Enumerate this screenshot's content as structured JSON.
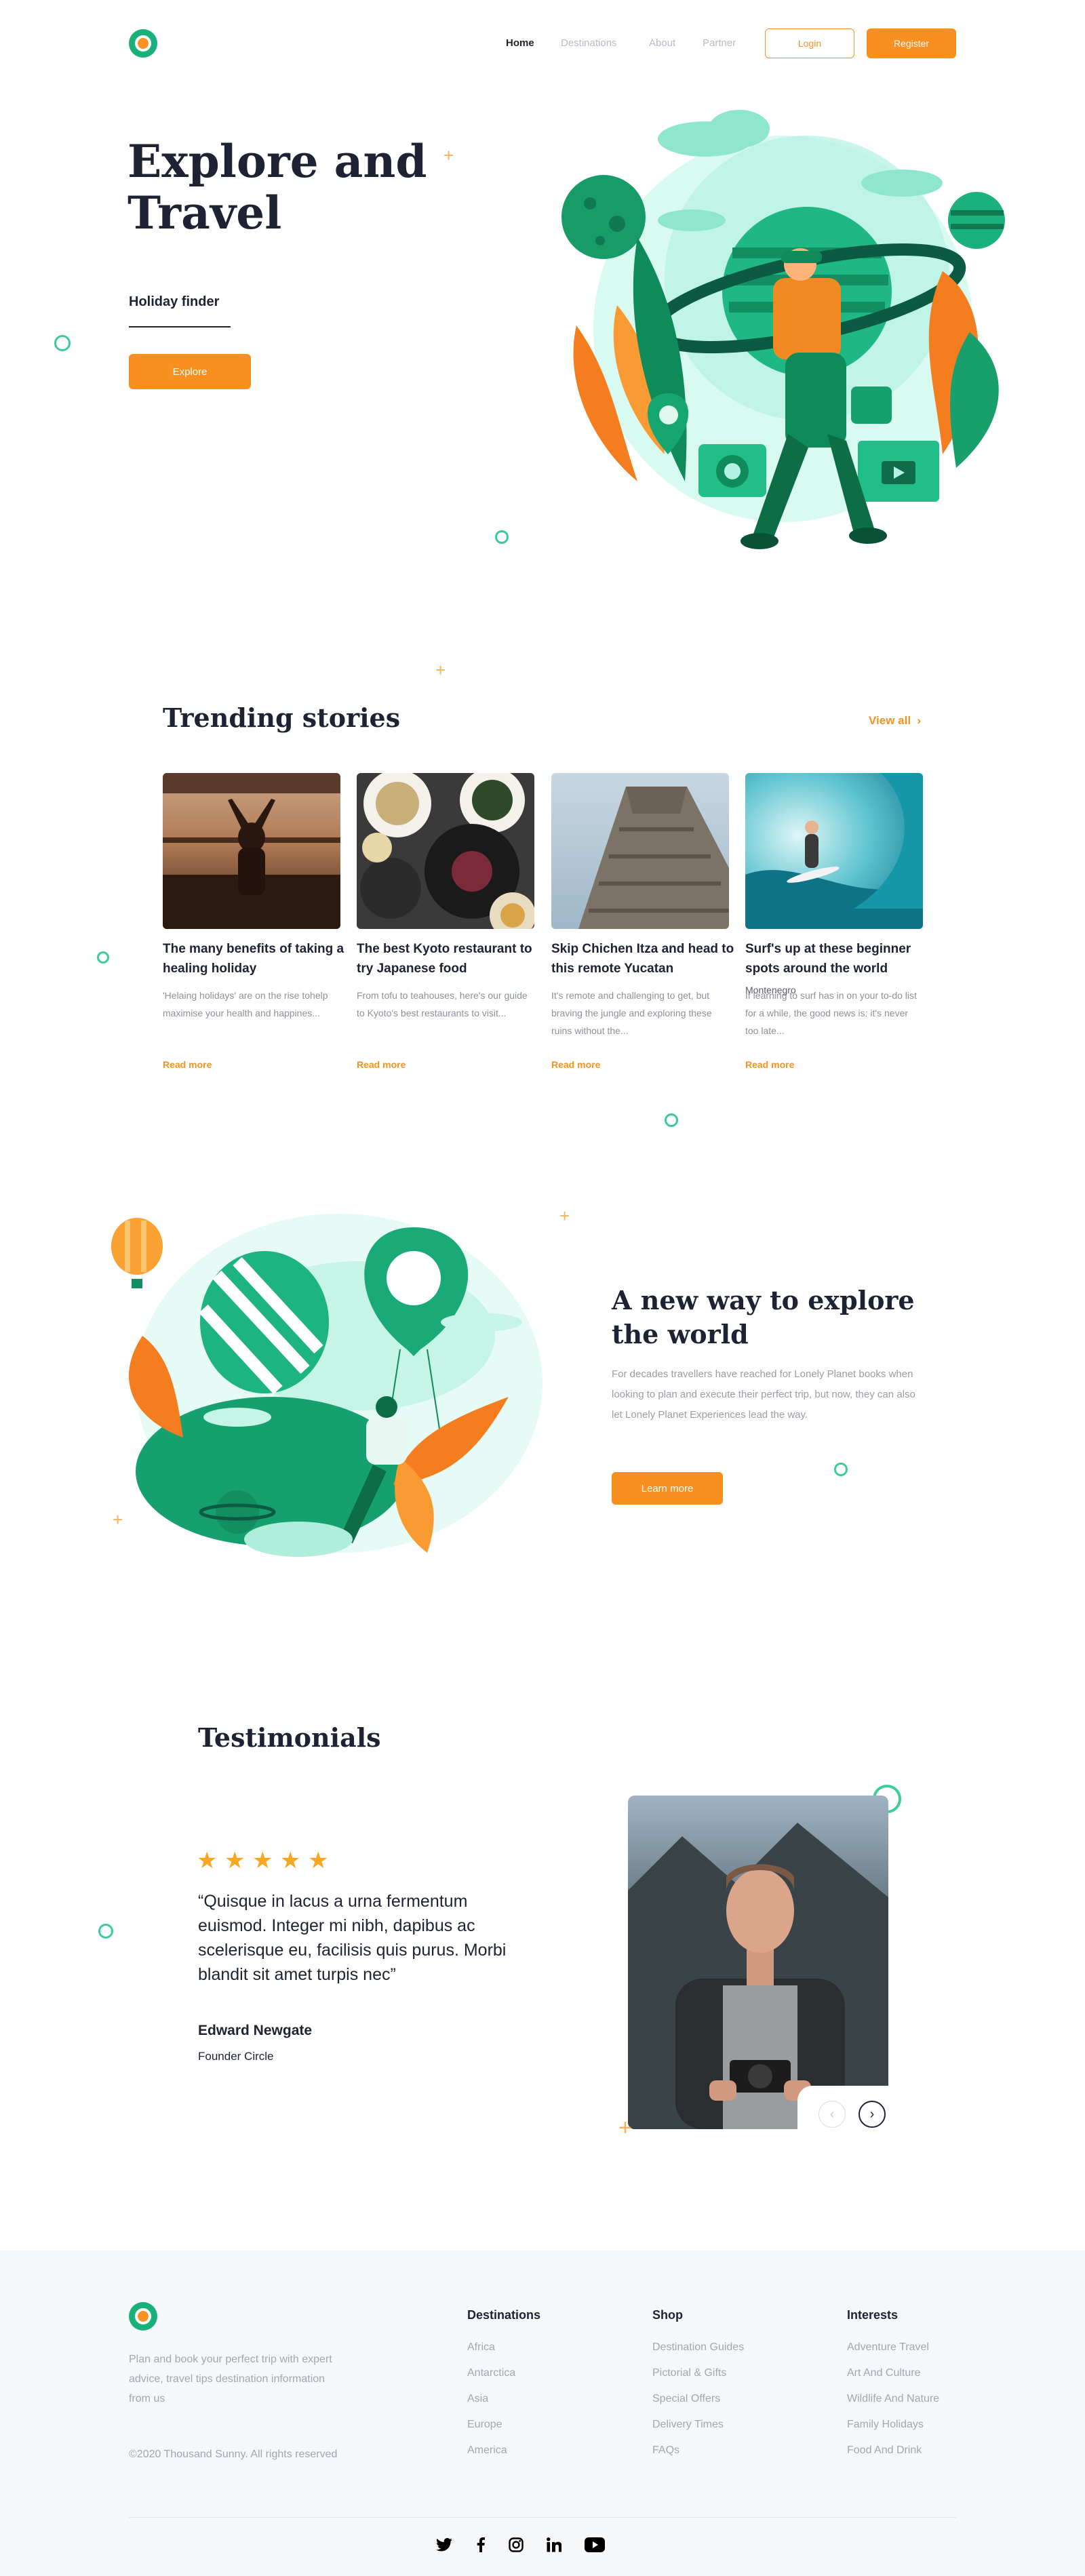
{
  "header": {
    "nav": [
      "Home",
      "Destinations",
      "About",
      "Partner"
    ],
    "login_label": "Login",
    "register_label": "Register"
  },
  "hero": {
    "title_line1": "Explore and",
    "title_line2": "Travel",
    "holiday_finder": "Holiday finder",
    "explore_label": "Explore"
  },
  "trending": {
    "title": "Trending stories",
    "view_all": "View all",
    "read_more": "Read more",
    "cards": [
      {
        "title": "The many benefits of taking a healing holiday",
        "text": "'Helaing holidays' are on the rise tohelp maximise your health and happines..."
      },
      {
        "title": "The best Kyoto restaurant to try Japanese food",
        "text": "From tofu to teahouses, here's our guide to Kyoto's best restaurants to visit..."
      },
      {
        "title": "Skip Chichen Itza and head to this remote Yucatan",
        "text": "It's remote and challenging to get, but braving the jungle and exploring these ruins without the..."
      },
      {
        "title": "Surf's up at these beginner spots around the world",
        "text": "If learning to surf has in on your to-do list for a while, the good news is: it's never too late...",
        "overlay": "Montenegro"
      }
    ]
  },
  "feature": {
    "title": "A new way to explore the world",
    "text": "For decades travellers have reached for Lonely Planet books when looking to plan and execute their perfect trip, but now, they can also let Lonely Planet Experiences lead the way.",
    "button_label": "Learn more"
  },
  "testimonials": {
    "title": "Testimonials",
    "rating": 5,
    "quote": "“Quisque in lacus a urna fermentum euismod. Integer mi nibh, dapibus ac scelerisque eu, facilisis quis purus. Morbi blandit sit amet turpis nec”",
    "author": "Edward Newgate",
    "role": "Founder Circle"
  },
  "footer": {
    "about": "Plan and book your perfect trip with expert advice, travel tips destination information from us",
    "copyright": "©2020 Thousand Sunny. All rights reserved",
    "columns": [
      {
        "heading": "Destinations",
        "items": [
          "Africa",
          "Antarctica",
          "Asia",
          "Europe",
          "America"
        ]
      },
      {
        "heading": "Shop",
        "items": [
          "Destination Guides",
          "Pictorial & Gifts",
          "Special Offers",
          "Delivery Times",
          "FAQs"
        ]
      },
      {
        "heading": "Interests",
        "items": [
          "Adventure Travel",
          "Art And Culture",
          "Wildlife And Nature",
          "Family Holidays",
          "Food And Drink"
        ]
      }
    ],
    "social_icons": [
      "twitter-icon",
      "facebook-icon",
      "instagram-icon",
      "linkedin-icon",
      "youtube-icon"
    ]
  },
  "colors": {
    "accent": "#f8901f",
    "green": "#19b07a",
    "text": "#1f2233",
    "muted": "#a3a6b0",
    "footer_bg": "#f6f7f9"
  }
}
